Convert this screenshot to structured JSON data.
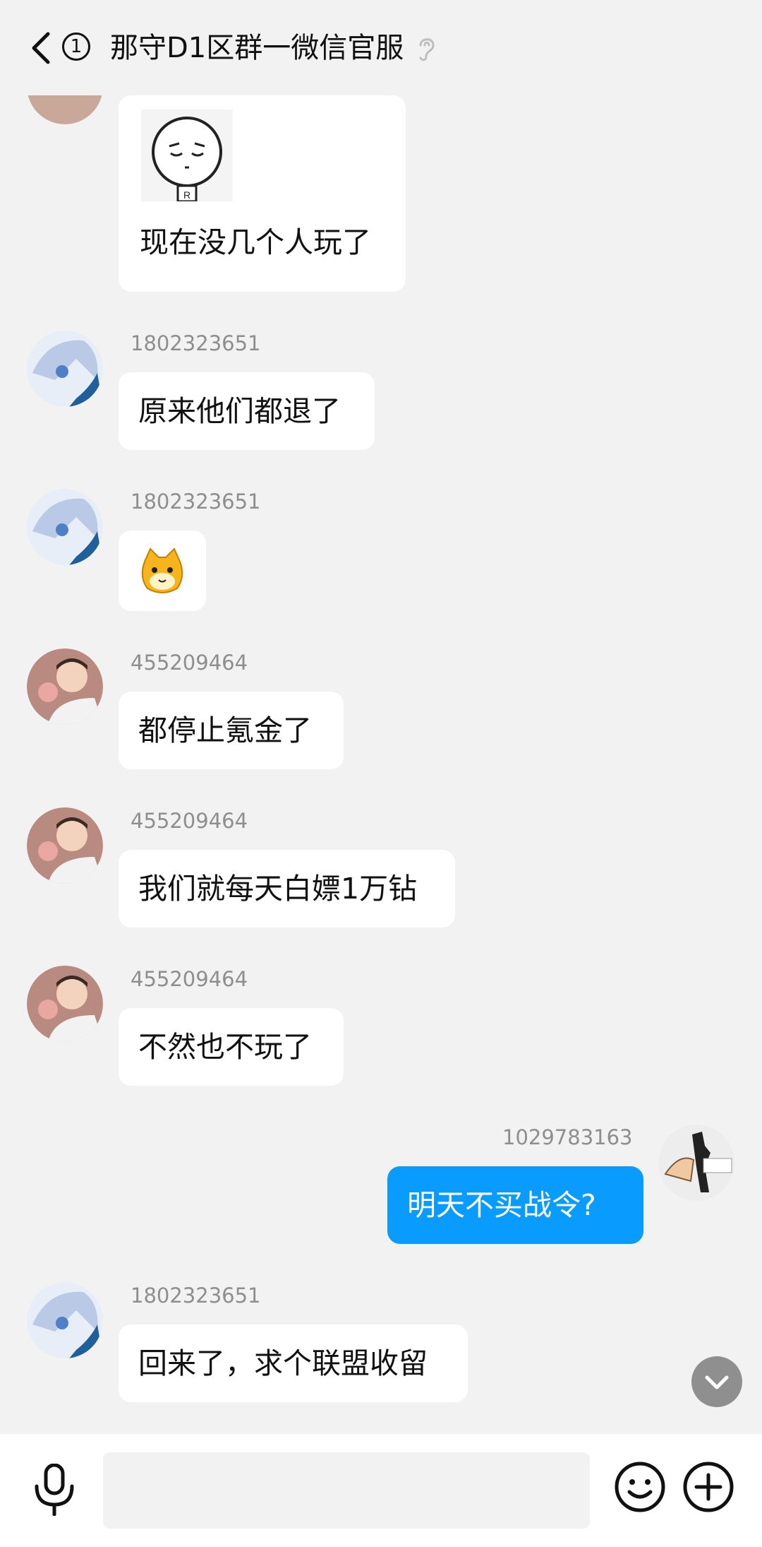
{
  "header": {
    "title": "那守D1区群一微信官服",
    "unread_count": "1"
  },
  "messages": [
    {
      "sender": "",
      "text": "现在没几个人玩了",
      "sticker": "shy-face-sticker",
      "avatar": "avatar-1"
    },
    {
      "sender": "1802323651",
      "text": "原来他们都退了",
      "avatar": "avatar-anime-girl"
    },
    {
      "sender": "1802323651",
      "text": "",
      "sticker": "cat-emoji",
      "avatar": "avatar-anime-girl"
    },
    {
      "sender": "455209464",
      "text": "都停止氪金了",
      "avatar": "avatar-boy-pig"
    },
    {
      "sender": "455209464",
      "text": "我们就每天白嫖1万钻",
      "avatar": "avatar-boy-pig"
    },
    {
      "sender": "455209464",
      "text": "不然也不玩了",
      "avatar": "avatar-boy-pig"
    },
    {
      "sender": "1029783163",
      "text": "明天不买战令?",
      "avatar": "avatar-self-drawing",
      "mine": true
    },
    {
      "sender": "1802323651",
      "text": "回来了，求个联盟收留",
      "avatar": "avatar-anime-girl"
    }
  ],
  "input": {
    "placeholder": ""
  },
  "colors": {
    "background": "#f2f2f2",
    "mine_bubble": "#0a9bff",
    "other_bubble": "#ffffff",
    "meta_text": "#8e8e8e"
  }
}
